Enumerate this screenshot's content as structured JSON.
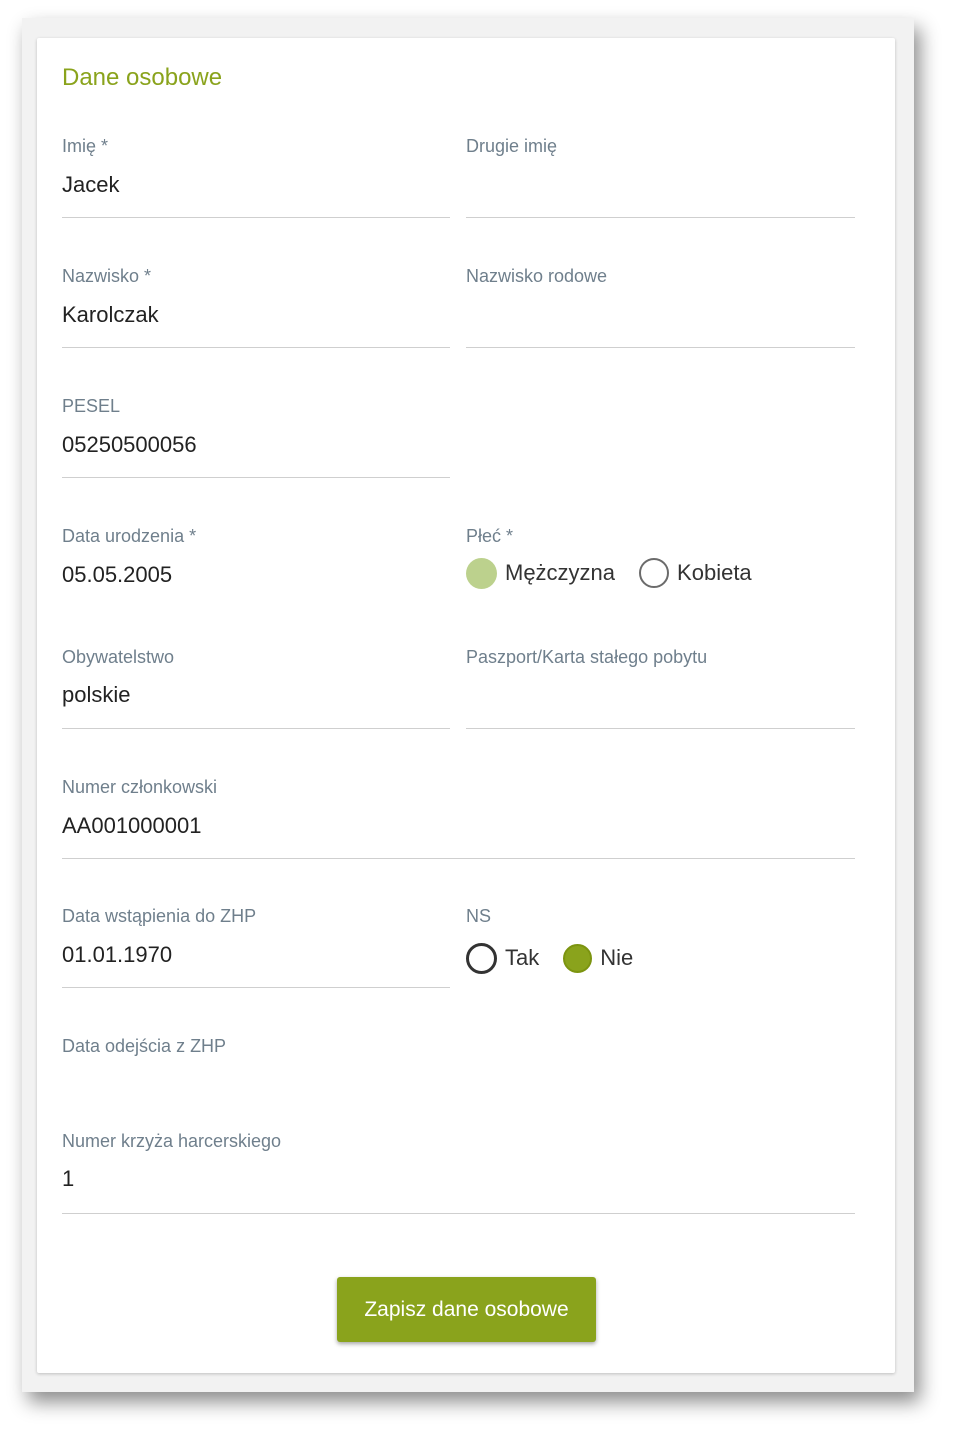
{
  "section": {
    "title": "Dane osobowe"
  },
  "fields": {
    "first_name": {
      "label": "Imię *",
      "value": "Jacek"
    },
    "second_name": {
      "label": "Drugie imię",
      "value": ""
    },
    "last_name": {
      "label": "Nazwisko *",
      "value": "Karolczak"
    },
    "family_name": {
      "label": "Nazwisko rodowe",
      "value": ""
    },
    "pesel": {
      "label": "PESEL",
      "value": "05250500056"
    },
    "birth_date": {
      "label": "Data urodzenia *",
      "value": "05.05.2005"
    },
    "gender": {
      "label": "Płeć *",
      "options": [
        {
          "label": "Mężczyzna",
          "selected": true
        },
        {
          "label": "Kobieta",
          "selected": false
        }
      ]
    },
    "citizenship": {
      "label": "Obywatelstwo",
      "value": "polskie"
    },
    "passport": {
      "label": "Paszport/Karta stałego pobytu",
      "value": ""
    },
    "member_number": {
      "label": "Numer członkowski",
      "value": "AA001000001"
    },
    "join_date": {
      "label": "Data wstąpienia do ZHP",
      "value": "01.01.1970"
    },
    "ns": {
      "label": "NS",
      "options": [
        {
          "label": "Tak",
          "selected": false
        },
        {
          "label": "Nie",
          "selected": true
        }
      ]
    },
    "leave_date": {
      "label": "Data odejścia z ZHP",
      "value": ""
    },
    "cross_number": {
      "label": "Numer krzyża harcerskiego",
      "value": "1"
    }
  },
  "actions": {
    "save_label": "Zapisz dane osobowe"
  },
  "colors": {
    "accent": "#8aa31c",
    "accent_light": "#bcd18d",
    "label": "#6f7f8c",
    "text": "#222222",
    "divider": "#cfcfcf"
  }
}
